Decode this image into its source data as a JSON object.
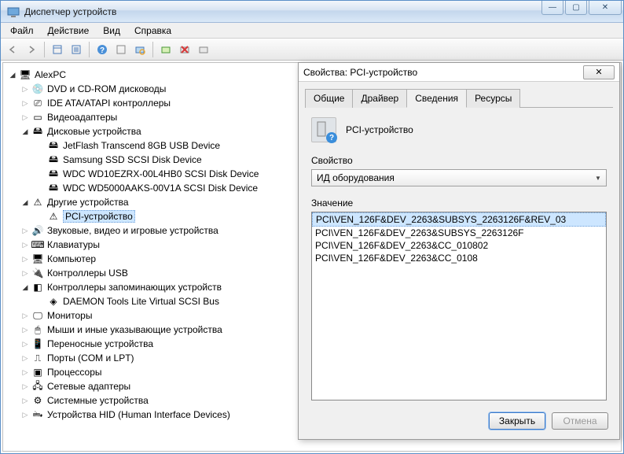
{
  "window": {
    "title": "Диспетчер устройств"
  },
  "menubar": {
    "items": [
      "Файл",
      "Действие",
      "Вид",
      "Справка"
    ]
  },
  "tree": {
    "root": "AlexPC",
    "nodes": [
      {
        "label": "DVD и CD-ROM дисководы",
        "icon": "cdrom",
        "expanded": false
      },
      {
        "label": "IDE ATA/ATAPI контроллеры",
        "icon": "ide",
        "expanded": false
      },
      {
        "label": "Видеоадаптеры",
        "icon": "display",
        "expanded": false
      },
      {
        "label": "Дисковые устройства",
        "icon": "disk",
        "expanded": true,
        "children": [
          {
            "label": "JetFlash Transcend 8GB USB Device",
            "icon": "disk"
          },
          {
            "label": "Samsung SSD SCSI Disk Device",
            "icon": "disk"
          },
          {
            "label": "WDC WD10EZRX-00L4HB0 SCSI Disk Device",
            "icon": "disk"
          },
          {
            "label": "WDC WD5000AAKS-00V1A SCSI Disk Device",
            "icon": "disk"
          }
        ]
      },
      {
        "label": "Другие устройства",
        "icon": "warning",
        "expanded": true,
        "children": [
          {
            "label": "PCI-устройство",
            "icon": "warning",
            "selected": true
          }
        ]
      },
      {
        "label": "Звуковые, видео и игровые устройства",
        "icon": "sound",
        "expanded": false
      },
      {
        "label": "Клавиатуры",
        "icon": "keyboard",
        "expanded": false
      },
      {
        "label": "Компьютер",
        "icon": "computer",
        "expanded": false
      },
      {
        "label": "Контроллеры USB",
        "icon": "usb",
        "expanded": false
      },
      {
        "label": "Контроллеры запоминающих устройств",
        "icon": "storage",
        "expanded": true,
        "children": [
          {
            "label": "DAEMON Tools Lite Virtual SCSI Bus",
            "icon": "scsi"
          }
        ]
      },
      {
        "label": "Мониторы",
        "icon": "monitor",
        "expanded": false
      },
      {
        "label": "Мыши и иные указывающие устройства",
        "icon": "mouse",
        "expanded": false
      },
      {
        "label": "Переносные устройства",
        "icon": "portable",
        "expanded": false
      },
      {
        "label": "Порты (COM и LPT)",
        "icon": "port",
        "expanded": false
      },
      {
        "label": "Процессоры",
        "icon": "cpu",
        "expanded": false
      },
      {
        "label": "Сетевые адаптеры",
        "icon": "network",
        "expanded": false
      },
      {
        "label": "Системные устройства",
        "icon": "system",
        "expanded": false
      },
      {
        "label": "Устройства HID (Human Interface Devices)",
        "icon": "hid",
        "expanded": false
      }
    ]
  },
  "dialog": {
    "title": "Свойства: PCI-устройство",
    "device_name": "PCI-устройство",
    "tabs": [
      "Общие",
      "Драйвер",
      "Сведения",
      "Ресурсы"
    ],
    "active_tab": 2,
    "property_label": "Свойство",
    "property_value": "ИД оборудования",
    "value_label": "Значение",
    "values": [
      "PCI\\VEN_126F&DEV_2263&SUBSYS_2263126F&REV_03",
      "PCI\\VEN_126F&DEV_2263&SUBSYS_2263126F",
      "PCI\\VEN_126F&DEV_2263&CC_010802",
      "PCI\\VEN_126F&DEV_2263&CC_0108"
    ],
    "selected_value": 0,
    "buttons": {
      "close": "Закрыть",
      "cancel": "Отмена"
    }
  },
  "icons": {
    "computer": "🖥",
    "cdrom": "💿",
    "disk": "🖴",
    "warning": "⚠",
    "sound": "🔊",
    "keyboard": "⌨",
    "usb": "🔌",
    "monitor": "🖵",
    "mouse": "🖱",
    "port": "⎍",
    "cpu": "▣",
    "network": "🖧",
    "system": "⚙",
    "hid": "🖦",
    "ide": "⎚",
    "display": "▭",
    "storage": "◧",
    "scsi": "◈",
    "portable": "📱"
  }
}
